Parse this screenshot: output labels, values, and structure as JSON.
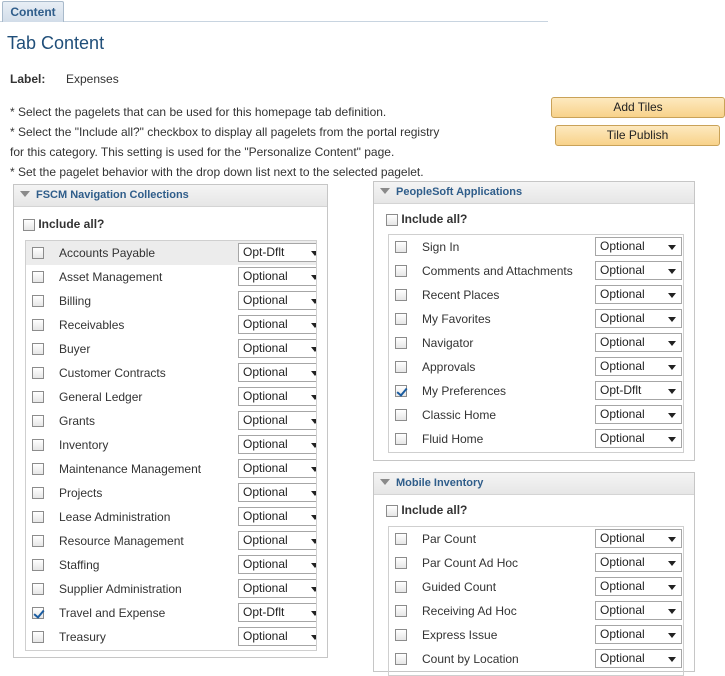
{
  "tab": {
    "label": "Content"
  },
  "page_title": "Tab Content",
  "label_field": {
    "key": "Label:",
    "value": "Expenses"
  },
  "instructions": [
    "* Select the pagelets that can be used for this homepage tab definition.",
    "* Select the \"Include all?\" checkbox to display all pagelets from the portal registry",
    "for this category. This setting is used for the \"Personalize Content\" page.",
    "* Set the pagelet behavior with the drop down list next to the selected pagelet."
  ],
  "buttons": {
    "add_tiles": "Add Tiles",
    "tile_publish": "Tile Publish"
  },
  "include_all_label": "Include all?",
  "sections": {
    "fscm": {
      "title": "FSCM Navigation Collections",
      "rows": [
        {
          "name": "Accounts Payable",
          "checked": false,
          "option": "Opt-Dflt"
        },
        {
          "name": "Asset Management",
          "checked": false,
          "option": "Optional"
        },
        {
          "name": "Billing",
          "checked": false,
          "option": "Optional"
        },
        {
          "name": "Receivables",
          "checked": false,
          "option": "Optional"
        },
        {
          "name": "Buyer",
          "checked": false,
          "option": "Optional"
        },
        {
          "name": "Customer Contracts",
          "checked": false,
          "option": "Optional"
        },
        {
          "name": "General Ledger",
          "checked": false,
          "option": "Optional"
        },
        {
          "name": "Grants",
          "checked": false,
          "option": "Optional"
        },
        {
          "name": "Inventory",
          "checked": false,
          "option": "Optional"
        },
        {
          "name": "Maintenance Management",
          "checked": false,
          "option": "Optional"
        },
        {
          "name": "Projects",
          "checked": false,
          "option": "Optional"
        },
        {
          "name": "Lease Administration",
          "checked": false,
          "option": "Optional"
        },
        {
          "name": "Resource Management",
          "checked": false,
          "option": "Optional"
        },
        {
          "name": "Staffing",
          "checked": false,
          "option": "Optional"
        },
        {
          "name": "Supplier Administration",
          "checked": false,
          "option": "Optional"
        },
        {
          "name": "Travel and Expense",
          "checked": true,
          "option": "Opt-Dflt"
        },
        {
          "name": "Treasury",
          "checked": false,
          "option": "Optional"
        }
      ]
    },
    "peoplesoft": {
      "title": "PeopleSoft Applications",
      "rows": [
        {
          "name": "Sign In",
          "checked": false,
          "option": "Optional"
        },
        {
          "name": "Comments and Attachments",
          "checked": false,
          "option": "Optional"
        },
        {
          "name": "Recent Places",
          "checked": false,
          "option": "Optional"
        },
        {
          "name": "My Favorites",
          "checked": false,
          "option": "Optional"
        },
        {
          "name": "Navigator",
          "checked": false,
          "option": "Optional"
        },
        {
          "name": "Approvals",
          "checked": false,
          "option": "Optional"
        },
        {
          "name": "My Preferences",
          "checked": true,
          "option": "Opt-Dflt"
        },
        {
          "name": "Classic Home",
          "checked": false,
          "option": "Optional"
        },
        {
          "name": "Fluid Home",
          "checked": false,
          "option": "Optional"
        }
      ]
    },
    "mobile": {
      "title": "Mobile Inventory",
      "rows": [
        {
          "name": "Par Count",
          "checked": false,
          "option": "Optional"
        },
        {
          "name": "Par Count Ad Hoc",
          "checked": false,
          "option": "Optional"
        },
        {
          "name": "Guided Count",
          "checked": false,
          "option": "Optional"
        },
        {
          "name": "Receiving Ad Hoc",
          "checked": false,
          "option": "Optional"
        },
        {
          "name": "Express Issue",
          "checked": false,
          "option": "Optional"
        },
        {
          "name": "Count by Location",
          "checked": false,
          "option": "Optional"
        }
      ]
    }
  }
}
